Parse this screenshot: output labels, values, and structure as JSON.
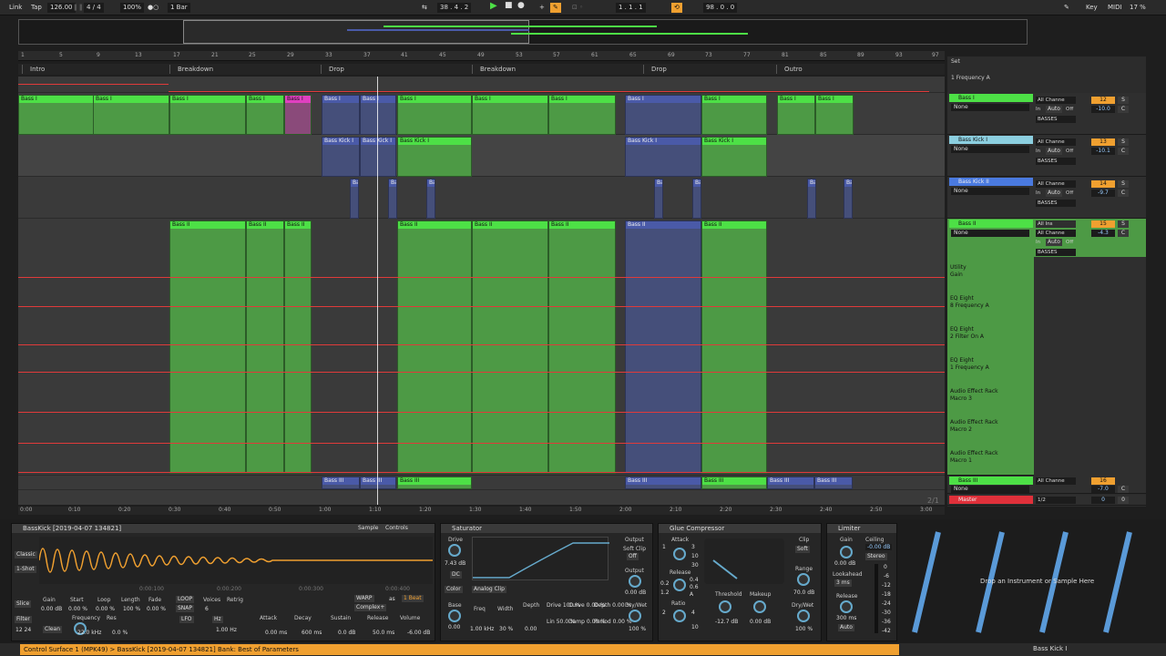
{
  "topbar": {
    "link": "Link",
    "tap": "Tap",
    "tempo": "126.00",
    "meter": "4 / 4",
    "zoom": "100%",
    "quantize": "1 Bar",
    "position": "38 . 4 . 2",
    "loop_start": "1 . 1 . 1",
    "loop_len": "98 . 0 . 0",
    "key": "Key",
    "midi": "MIDI",
    "cpu": "17 %"
  },
  "ruler": [
    "1",
    "5",
    "9",
    "13",
    "17",
    "21",
    "25",
    "29",
    "33",
    "37",
    "41",
    "45",
    "49",
    "53",
    "57",
    "61",
    "65",
    "69",
    "73",
    "77",
    "81",
    "85",
    "89",
    "93",
    "97"
  ],
  "locators": [
    {
      "label": "Intro"
    },
    {
      "label": "Breakdown"
    },
    {
      "label": "Drop"
    },
    {
      "label": "Breakdown"
    },
    {
      "label": "Drop"
    },
    {
      "label": "Outro"
    }
  ],
  "clips": {
    "bass1": "Bass I",
    "basskick1": "Bass Kick I",
    "basskick1b": "Bass Kick I",
    "ba": "Ba",
    "bass2": "Bass II",
    "bass3": "Bass III"
  },
  "timebar": [
    "0:00",
    "0:10",
    "0:20",
    "0:30",
    "0:40",
    "0:50",
    "1:00",
    "1:10",
    "1:20",
    "1:30",
    "1:40",
    "1:50",
    "2:00",
    "2:10",
    "2:20",
    "2:30",
    "2:40",
    "2:50",
    "3:00"
  ],
  "page_indicator": "2/1",
  "mixer": {
    "set_label": "Set",
    "top_param": "1 Frequency A",
    "tracks": [
      {
        "name": "Bass I",
        "input": "None",
        "channel": "All Channe",
        "group": "BASSES",
        "number": "12",
        "volume": "-10.0",
        "pan": "C",
        "color": "#4de046"
      },
      {
        "name": "Bass Kick I",
        "input": "None",
        "channel": "All Channe",
        "group": "BASSES",
        "number": "13",
        "volume": "-10.1",
        "pan": "C",
        "color": "#8ccfe0"
      },
      {
        "name": "Bass Kick II",
        "input": "None",
        "channel": "All Channe",
        "group": "BASSES",
        "number": "14",
        "volume": "-9.7",
        "pan": "C",
        "color": "#4a7ae0"
      },
      {
        "name": "Bass II",
        "input": "None",
        "channel": "All Channe",
        "group": "BASSES",
        "number": "15",
        "volume": "-4.3",
        "pan": "C",
        "color": "#4de046",
        "allins": "All Ins"
      }
    ],
    "automation_lanes": [
      {
        "device": "Utility",
        "param": "Gain"
      },
      {
        "device": "EQ Eight",
        "param": "8 Frequency A"
      },
      {
        "device": "EQ Eight",
        "param": "2 Filter On A"
      },
      {
        "device": "EQ Eight",
        "param": "1 Frequency A"
      },
      {
        "device": "Audio Effect Rack",
        "param": "Macro 3"
      },
      {
        "device": "Audio Effect Rack",
        "param": "Macro 2"
      },
      {
        "device": "Audio Effect Rack",
        "param": "Macro 1"
      }
    ],
    "bass3": {
      "name": "Bass III",
      "input": "None",
      "channel": "All Channe",
      "number": "16",
      "volume": "-7.0",
      "pan": "C"
    },
    "master": {
      "name": "Master",
      "routing": "1/2",
      "number": "0",
      "pan": "0"
    },
    "in_label": "In",
    "auto_label": "Auto",
    "off_label": "Off",
    "s_label": "S"
  },
  "devices": {
    "simpler": {
      "title": "BassKick [2019-04-07 134821]",
      "tab_sample": "Sample",
      "tab_controls": "Controls",
      "modes": [
        "Classic",
        "1-Shot",
        "Slice"
      ],
      "time_marks": [
        "0:00:100",
        "0:00:200",
        "0:00:300",
        "0:00:400"
      ],
      "warp": "WARP",
      "warp_ratio": "as",
      "beats": "1 Beat",
      "complex": "Complex+",
      "params": [
        {
          "label": "Gain",
          "value": "0.00 dB"
        },
        {
          "label": "Start",
          "value": "0.00 %"
        },
        {
          "label": "Loop",
          "value": "0.00 %"
        },
        {
          "label": "Length",
          "value": "100 %"
        },
        {
          "label": "Fade",
          "value": "0.00 %"
        }
      ],
      "voices_label": "Voices",
      "voices": "6",
      "retrig": "Retrig",
      "loop_btn": "LOOP",
      "snap_btn": "SNAP",
      "filter": "Filter",
      "filter_type": "Clean",
      "filter_slope": "12 24",
      "freq_label": "Frequency",
      "freq": "22.0 kHz",
      "res_label": "Res",
      "res": "0.0 %",
      "lfo": "LFO",
      "lfo_hz": "Hz",
      "lfo_rate": "1.00 Hz",
      "env": [
        {
          "label": "Attack",
          "value": "0.00 ms"
        },
        {
          "label": "Decay",
          "value": "600 ms"
        },
        {
          "label": "Sustain",
          "value": "0.0 dB"
        },
        {
          "label": "Release",
          "value": "50.0 ms"
        },
        {
          "label": "Volume",
          "value": "-6.00 dB"
        }
      ]
    },
    "saturator": {
      "title": "Saturator",
      "drive_label": "Drive",
      "drive": "7.43 dB",
      "dc": "DC",
      "color": "Color",
      "type": "Analog Clip",
      "output_label": "Output",
      "soft_clip": "Soft Clip",
      "off": "Off",
      "output": "0.00 dB",
      "base_label": "Base",
      "base": "0.00",
      "freq_label": "Freq",
      "freq": "1.00 kHz",
      "width_label": "Width",
      "width": "30 %",
      "depth_label": "Depth",
      "depth": "0.00",
      "drive2": "Drive 100 %",
      "lin": "Lin 50.0 %",
      "curve": "Curve 0.00 %",
      "damp": "Damp 0.00 %",
      "depth2": "Depth 0.00 %",
      "period": "Period 0.00 %",
      "drywet_label": "Dry/Wet",
      "drywet": "100 %"
    },
    "glue": {
      "title": "Glue Compressor",
      "attack_label": "Attack",
      "attack_vals": [
        "1",
        "3",
        "10",
        "30"
      ],
      "release_label": "Release",
      "release_vals": [
        "0.2",
        "0.4",
        "0.6",
        "1.2",
        "A"
      ],
      "ratio_label": "Ratio",
      "ratio_vals": [
        "2",
        "4",
        "10"
      ],
      "threshold_label": "Threshold",
      "threshold": "-12.7 dB",
      "makeup_label": "Makeup",
      "makeup": "0.00 dB",
      "clip_label": "Clip",
      "soft": "Soft",
      "range_label": "Range",
      "range": "70.0 dB",
      "drywet_label": "Dry/Wet",
      "drywet": "100 %"
    },
    "limiter": {
      "title": "Limiter",
      "gain_label": "Gain",
      "gain": "0.00 dB",
      "ceiling_label": "Ceiling",
      "ceiling": "-0.00 dB",
      "stereo": "Stereo",
      "lookahead_label": "Lookahead",
      "lookahead": "3 ms",
      "release_label": "Release",
      "release": "300 ms",
      "auto": "Auto",
      "scale": [
        "0",
        "-6",
        "-12",
        "-18",
        "-24",
        "-30",
        "-36",
        "-42"
      ]
    },
    "drop_hint": "Drop an Instrument or Sample Here"
  },
  "status": {
    "message": "Control Surface 1 (MPK49) > BassKick [2019-04-07 134821] Bank: Best of Parameters",
    "track": "Bass Kick I"
  }
}
